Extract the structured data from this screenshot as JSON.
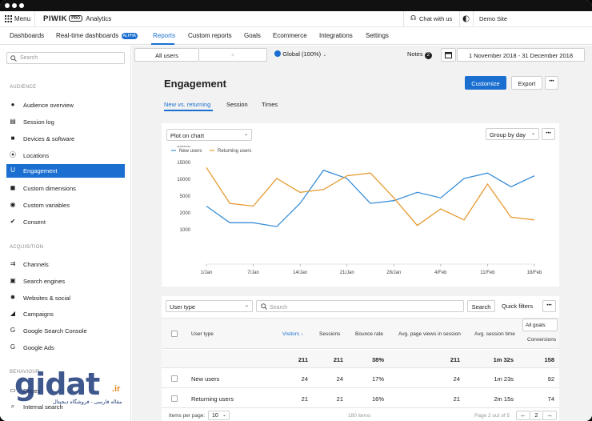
{
  "topbar": {
    "menu_label": "Menu",
    "brand": "PIWIK",
    "brand_badge": "PRO",
    "brand_suffix": "Analytics",
    "chat_label": "Chat with us",
    "site_name": "Demo Site"
  },
  "nav": {
    "items": [
      {
        "label": "Dashboards"
      },
      {
        "label": "Real-time dashboards",
        "badge": "ALPHA"
      },
      {
        "label": "Reports"
      },
      {
        "label": "Custom reports"
      },
      {
        "label": "Goals"
      },
      {
        "label": "Ecommerce"
      },
      {
        "label": "Integrations"
      },
      {
        "label": "Settings"
      }
    ],
    "active_index": 2
  },
  "sidebar": {
    "search_placeholder": "Search",
    "audience_header": "AUDIENCE",
    "audience_items": [
      {
        "label": "Audience overview",
        "icon": "people-icon"
      },
      {
        "label": "Session log",
        "icon": "log-icon"
      },
      {
        "label": "Devices & software",
        "icon": "devices-icon"
      },
      {
        "label": "Locations",
        "icon": "location-pin-icon"
      },
      {
        "label": "Engagement",
        "icon": "magnet-icon"
      },
      {
        "label": "Custom dimensions",
        "icon": "cube-icon"
      },
      {
        "label": "Custom variables",
        "icon": "variables-icon"
      },
      {
        "label": "Consent",
        "icon": "check-circle-icon"
      }
    ],
    "active_item": "Engagement",
    "acquisition_header": "ACQUISITION",
    "acquisition_items": [
      {
        "label": "Channels",
        "icon": "channels-icon"
      },
      {
        "label": "Search engines",
        "icon": "search-engines-icon"
      },
      {
        "label": "Websites & social",
        "icon": "websites-icon"
      },
      {
        "label": "Campaigns",
        "icon": "megaphone-icon"
      },
      {
        "label": "Google Search Console",
        "icon": "google-icon"
      },
      {
        "label": "Google Ads",
        "icon": "google-icon"
      }
    ],
    "behaviour_header": "BEHAVIOUR",
    "behaviour_items": [
      {
        "label": "Pages",
        "icon": "pages-icon"
      },
      {
        "label": "Internal search",
        "icon": "internal-search-icon"
      }
    ]
  },
  "toolbar": {
    "segment": "All users",
    "add_label": "+",
    "scope": "Global (100%)",
    "notes_label": "Notes",
    "notes_count": "2",
    "date_range": "1 November 2018 - 31 December 2018"
  },
  "page": {
    "title": "Engagement",
    "customize_label": "Customize",
    "export_label": "Export",
    "more_label": "•••",
    "tabs": [
      {
        "label": "New vs. returning"
      },
      {
        "label": "Session"
      },
      {
        "label": "Times"
      }
    ],
    "active_tab": 0
  },
  "chart_panel": {
    "plot_select": "Plot on chart",
    "group_select": "Group by day",
    "more_label": "•••"
  },
  "chart_data": {
    "type": "line",
    "title": "",
    "xlabel": "",
    "ylabel": "",
    "ylim": [
      0,
      20000
    ],
    "yticks": [
      1000,
      2000,
      5000,
      10000,
      15000,
      20000
    ],
    "x_tick_labels": [
      "1/Jan",
      "7/Jan",
      "14/Jan",
      "21/Jan",
      "28/Jan",
      "4/Feb",
      "11/Feb",
      "18/Feb"
    ],
    "legend_position": "top-left",
    "grid": false,
    "series": [
      {
        "name": "New users",
        "color": "#3b8ed8",
        "values": [
          10500,
          7500,
          7500,
          6800,
          11000,
          17000,
          15500,
          11000,
          11500,
          13000,
          12000,
          15500,
          16500,
          14000,
          16000
        ]
      },
      {
        "name": "Returning users",
        "color": "#e59a2f",
        "values": [
          17500,
          11000,
          10500,
          15500,
          13000,
          13500,
          16000,
          16500,
          12000,
          7000,
          10000,
          8000,
          14500,
          8500,
          8000
        ]
      }
    ]
  },
  "table": {
    "dimension_select": "User type",
    "search_placeholder": "Search",
    "search_button": "Search",
    "quick_filters_label": "Quick filters",
    "more_label": "•••",
    "goal_select": "All goals",
    "columns": [
      "User type",
      "Visitors",
      "Sessions",
      "Bounce rate",
      "Avg. page views in session",
      "Avg. session time",
      "Conversions"
    ],
    "total": {
      "visitors": "211",
      "sessions": "211",
      "bounce": "38%",
      "pageviews": "211",
      "time": "1m 32s",
      "conversions": "158"
    },
    "rows": [
      {
        "label": "New users",
        "visitors": "24",
        "sessions": "24",
        "bounce": "17%",
        "pageviews": "24",
        "time": "1m 23s",
        "conversions": "92"
      },
      {
        "label": "Returning users",
        "visitors": "21",
        "sessions": "21",
        "bounce": "16%",
        "pageviews": "21",
        "time": "2m 15s",
        "conversions": "74"
      }
    ],
    "footer": {
      "items_per_page_label": "Items per page:",
      "items_per_page": "10",
      "items_count": "180 items",
      "page_info": "Page 2 out of 5",
      "page_number": "2"
    }
  },
  "watermark": {
    "brand": "gidat",
    "tld": ".ir",
    "tagline": "مقاله فارسی - فروشگاه دیجیتال"
  }
}
